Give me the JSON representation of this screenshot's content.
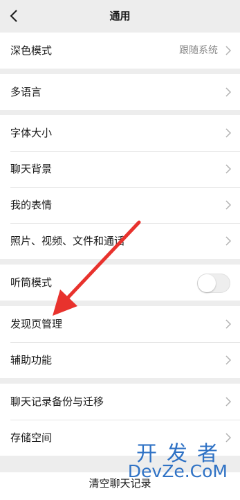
{
  "nav": {
    "title": "通用",
    "back_icon": "chevron-left-icon"
  },
  "groups": [
    {
      "rows": [
        {
          "label": "深色模式",
          "value": "跟随系统"
        }
      ]
    },
    {
      "rows": [
        {
          "label": "多语言"
        }
      ]
    },
    {
      "rows": [
        {
          "label": "字体大小"
        },
        {
          "label": "聊天背景"
        },
        {
          "label": "我的表情"
        },
        {
          "label": "照片、视频、文件和通话"
        }
      ]
    },
    {
      "rows": [
        {
          "label": "听筒模式",
          "toggle_on": false
        }
      ]
    },
    {
      "rows": [
        {
          "label": "发现页管理"
        },
        {
          "label": "辅助功能"
        }
      ]
    },
    {
      "rows": [
        {
          "label": "聊天记录备份与迁移"
        },
        {
          "label": "存储空间"
        }
      ]
    }
  ],
  "clear_button": {
    "label": "清空聊天记录"
  },
  "annotation": {
    "arrow_color": "#e8322d",
    "icon": "red-arrow-icon"
  },
  "watermark": {
    "top": "开发者",
    "bottom": "DevZe.CoM",
    "color": "#2f72c5"
  },
  "colors": {
    "background": "#ededed",
    "cell": "#ffffff",
    "secondary_text": "#888888"
  }
}
